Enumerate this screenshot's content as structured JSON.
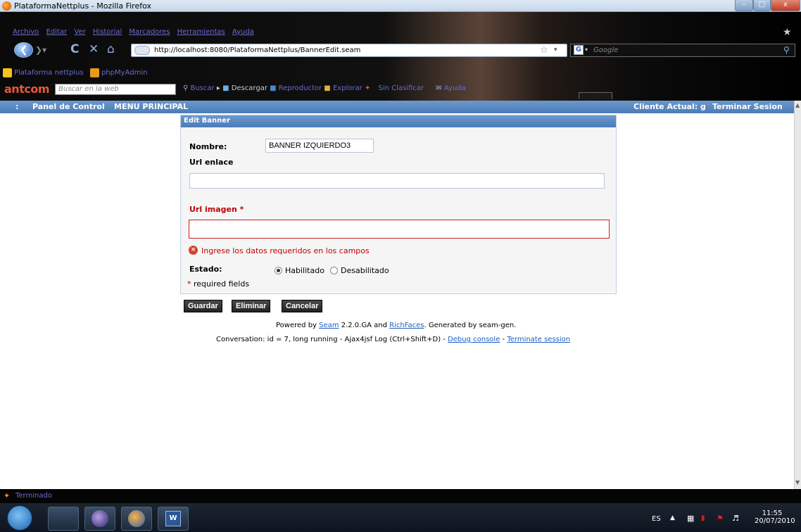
{
  "window": {
    "title": "PlataformaNettplus - Mozilla Firefox"
  },
  "menu": [
    "Archivo",
    "Editar",
    "Ver",
    "Historial",
    "Marcadores",
    "Herramientas",
    "Ayuda"
  ],
  "urlbar": {
    "url": "http://localhost:8080/PlataformaNettplus/BannerEdit.seam"
  },
  "searchbox": {
    "engine": "Google",
    "placeholder": "Google"
  },
  "bookmarks": [
    "Plataforma nettplus",
    "phpMyAdmin"
  ],
  "ant_toolbar": {
    "brand": "antcom",
    "search_placeholder": "Buscar en la web",
    "items": [
      "Buscar",
      "Descargar",
      "Reproductor",
      "Explorar",
      "Sin Clasificar",
      "Ayuda"
    ]
  },
  "pagebar": {
    "left": [
      ":",
      "Panel de Control",
      "MENU PRINCIPAL"
    ],
    "client": "Cliente Actual: g",
    "logout": "Terminar Sesion"
  },
  "form": {
    "header": "Edit Banner",
    "nombre_label": "Nombre:",
    "nombre_value": "BANNER IZQUIERDO3",
    "url_enlace_label": "Url enlace",
    "url_enlace_value": "",
    "url_imagen_label": "Url imagen",
    "required_mark": "*",
    "url_imagen_value": "",
    "error_message": "Ingrese los datos requeridos en los campos",
    "estado_label": "Estado:",
    "estado_options": [
      "Habilitado",
      "Desabilitado"
    ],
    "estado_selected": "Habilitado",
    "required_note": "required fields"
  },
  "buttons": {
    "save": "Guardar",
    "delete": "Eliminar",
    "cancel": "Cancelar"
  },
  "footer": {
    "powered_prefix": "Powered by",
    "seam": "Seam",
    "seam_version": "2.2.0.GA and",
    "richfaces": "RichFaces",
    "generated": ". Generated by seam-gen.",
    "conversation": "Conversation: id = 7, long running - Ajax4jsf Log (Ctrl+Shift+D) -",
    "debug": "Debug console",
    "dash": "-",
    "terminate": "Terminate session"
  },
  "status": {
    "text": "Terminado"
  },
  "taskbar": {
    "lang": "ES",
    "time": "11:55",
    "date": "20/07/2010"
  },
  "colors": {
    "accent": "#4a7cb9",
    "error": "#c00000",
    "link": "#2060c0"
  }
}
